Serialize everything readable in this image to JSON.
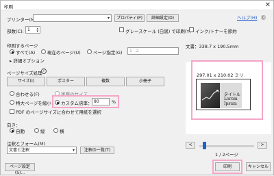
{
  "window": {
    "title": "印刷",
    "close_label": "✕"
  },
  "printer": {
    "label": "プリンター(N):",
    "value": "",
    "properties_button": "プロパティ(P)",
    "advanced_button": "詳細設定(D)",
    "help_link": "ヘルプ(H)"
  },
  "copies": {
    "label": "部数(C):",
    "value": "1"
  },
  "options": {
    "grayscale_label": "グレースケール (白黒) で印刷(Y)",
    "save_ink_label": "インク/トナーを節約"
  },
  "pages": {
    "title": "印刷するページ",
    "all_label": "すべて(A)",
    "current_label": "現在のページ(U)",
    "range_label": "ページ指定(G)",
    "range_value": "1 - 2",
    "more_options_label": "▸ 詳細オプション"
  },
  "sizing": {
    "title": "ページサイズ処理",
    "info_icon": "i",
    "tabs": [
      "サイズ(I)",
      "ポスター",
      "複数",
      "小冊子"
    ],
    "fit_label": "合わせる(F)",
    "actual_label": "実際のサイズ",
    "shrink_label": "特大ページを縮小",
    "custom_label": "カスタム倍率：",
    "custom_value": "80",
    "custom_unit": "%",
    "pdf_paper_label": "PDF のページサイズに合わせて用紙を選択"
  },
  "orientation": {
    "title": "向き：",
    "auto_label": "自動",
    "portrait_label": "縦",
    "landscape_label": "横"
  },
  "comments": {
    "title": "注釈とフォーム(M)",
    "value": "文書と注釈",
    "summarize_button": "注釈の一覧(T)"
  },
  "preview": {
    "doc_size": "文書：338.7 x 190.5mm",
    "paper_size": "297.01 x 210.02 ミリ",
    "slide_title": "タイトル",
    "slide_subtitle": "Lorem Ipsum",
    "prev_label": "<",
    "next_label": ">",
    "page_indicator": "1 / 2ページ"
  },
  "footer": {
    "page_setup_button": "ページ設定(S)...",
    "print_button": "印刷",
    "cancel_button": "キャンセル"
  },
  "colors": {
    "highlight": "#f5a6c8",
    "accent": "#1d63c9",
    "link": "#1a55c9"
  }
}
